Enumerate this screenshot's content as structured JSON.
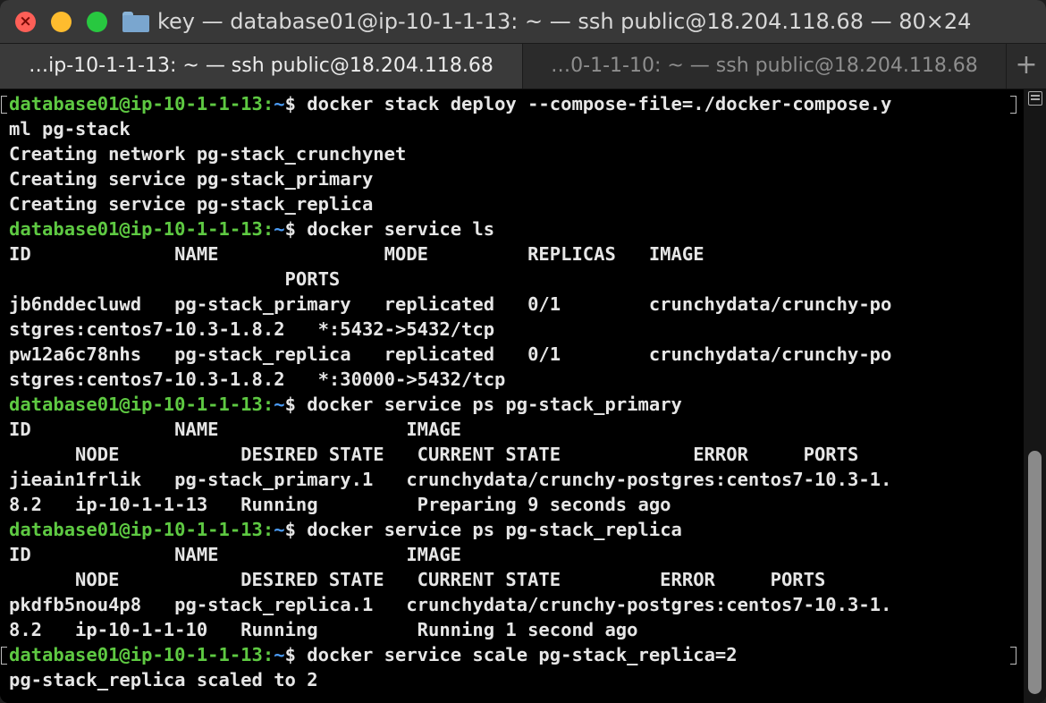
{
  "window": {
    "title": "key — database01@ip-10-1-1-13: ~ — ssh public@18.204.118.68 — 80×24"
  },
  "tabs": [
    {
      "label": "…ip-10-1-1-13: ~ — ssh public@18.204.118.68",
      "active": true
    },
    {
      "label": "…0-1-1-10: ~ — ssh public@18.204.118.68",
      "active": false
    }
  ],
  "tab_add_label": "+",
  "prompt": {
    "user": "database01@ip-10-1-1-13",
    "sep": ":",
    "path": "~",
    "symbol": "$ "
  },
  "terminal": {
    "lines": [
      {
        "type": "prompt",
        "text": "docker stack deploy --compose-file=./docker-compose.y"
      },
      {
        "type": "output",
        "text": "ml pg-stack"
      },
      {
        "type": "output",
        "text": "Creating network pg-stack_crunchynet"
      },
      {
        "type": "output",
        "text": "Creating service pg-stack_primary"
      },
      {
        "type": "output",
        "text": "Creating service pg-stack_replica"
      },
      {
        "type": "prompt",
        "text": "docker service ls"
      },
      {
        "type": "output",
        "text": "ID             NAME               MODE         REPLICAS   IMAGE"
      },
      {
        "type": "output",
        "text": "                         PORTS"
      },
      {
        "type": "output",
        "text": "jb6nddecluwd   pg-stack_primary   replicated   0/1        crunchydata/crunchy-po"
      },
      {
        "type": "output",
        "text": "stgres:centos7-10.3-1.8.2   *:5432->5432/tcp"
      },
      {
        "type": "output",
        "text": "pw12a6c78nhs   pg-stack_replica   replicated   0/1        crunchydata/crunchy-po"
      },
      {
        "type": "output",
        "text": "stgres:centos7-10.3-1.8.2   *:30000->5432/tcp"
      },
      {
        "type": "prompt",
        "text": "docker service ps pg-stack_primary"
      },
      {
        "type": "output",
        "text": "ID             NAME                 IMAGE"
      },
      {
        "type": "output",
        "text": "      NODE           DESIRED STATE   CURRENT STATE            ERROR     PORTS"
      },
      {
        "type": "output",
        "text": "jieain1frlik   pg-stack_primary.1   crunchydata/crunchy-postgres:centos7-10.3-1."
      },
      {
        "type": "output",
        "text": "8.2   ip-10-1-1-13   Running         Preparing 9 seconds ago"
      },
      {
        "type": "prompt",
        "text": "docker service ps pg-stack_replica"
      },
      {
        "type": "output",
        "text": "ID             NAME                 IMAGE"
      },
      {
        "type": "output",
        "text": "      NODE           DESIRED STATE   CURRENT STATE         ERROR     PORTS"
      },
      {
        "type": "output",
        "text": "pkdfb5nou4p8   pg-stack_replica.1   crunchydata/crunchy-postgres:centos7-10.3-1."
      },
      {
        "type": "output",
        "text": "8.2   ip-10-1-1-10   Running         Running 1 second ago"
      },
      {
        "type": "prompt",
        "text": "docker service scale pg-stack_replica=2"
      },
      {
        "type": "output",
        "text": "pg-stack_replica scaled to 2"
      }
    ]
  },
  "colors": {
    "prompt_user": "#5ec942",
    "prompt_path": "#4b9cf5",
    "text": "#e6e6e6",
    "background": "#000000"
  }
}
